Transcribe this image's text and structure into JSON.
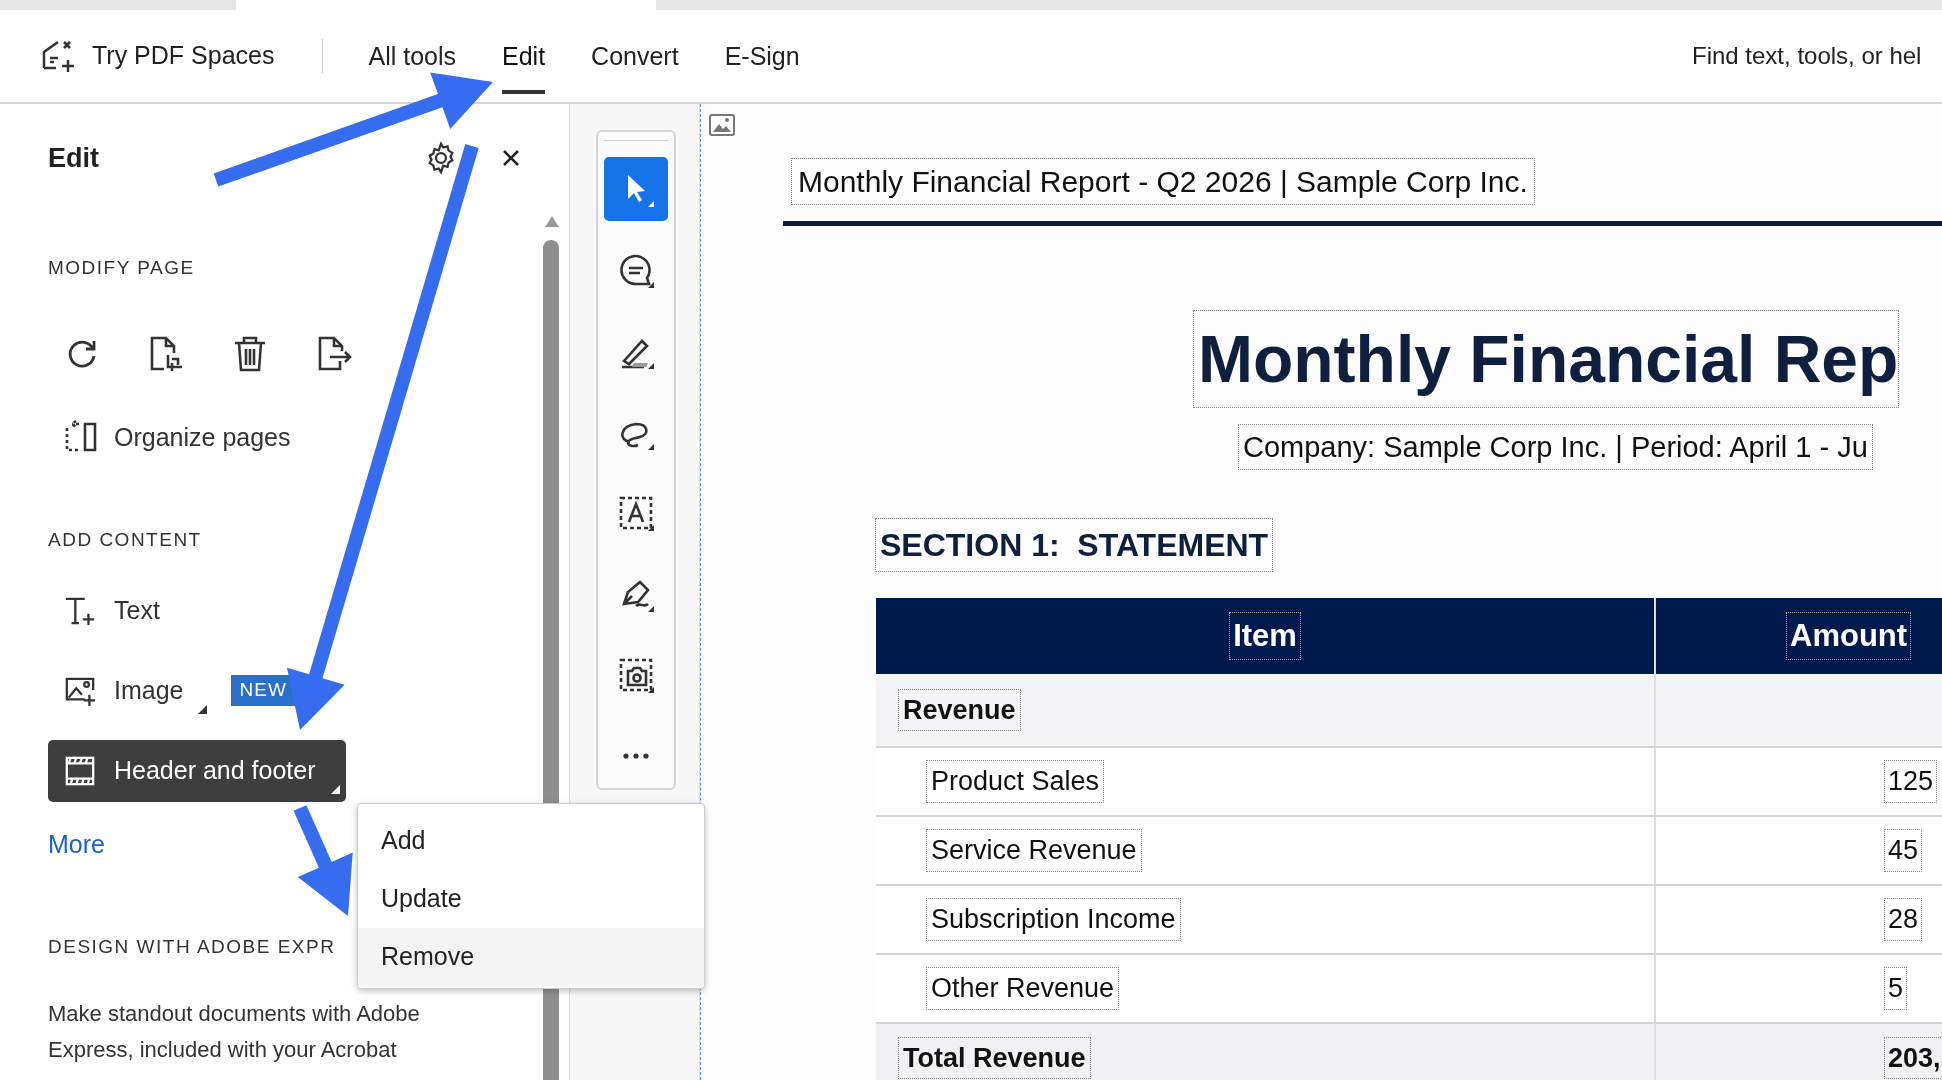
{
  "top_bar": {
    "brand": "Try PDF Spaces",
    "tabs": [
      {
        "label": "All tools",
        "selected": false
      },
      {
        "label": "Edit",
        "selected": true
      },
      {
        "label": "Convert",
        "selected": false
      },
      {
        "label": "E-Sign",
        "selected": false
      }
    ],
    "search": {
      "placeholder": "Find text, tools, or hel"
    }
  },
  "panel": {
    "title": "Edit",
    "modify_heading": "MODIFY PAGE",
    "organize_label": "Organize pages",
    "add_heading": "ADD CONTENT",
    "add_items": [
      {
        "kind": "text",
        "label": "Text",
        "selected": false,
        "has_menu": false
      },
      {
        "kind": "image",
        "label": "Image",
        "badge": "NEW",
        "selected": false,
        "has_menu": true
      },
      {
        "kind": "header_footer",
        "label": "Header and footer",
        "selected": true,
        "has_menu": true
      }
    ],
    "more": "More",
    "design_heading": "DESIGN WITH ADOBE EXPR",
    "design_text": "Make standout documents with Adobe Express, included with your Acrobat"
  },
  "menu": [
    {
      "label": "Add",
      "highlighted": false
    },
    {
      "label": "Update",
      "highlighted": false
    },
    {
      "label": "Remove",
      "highlighted": true
    }
  ],
  "tools": [
    {
      "kind": "select",
      "selected": true
    },
    {
      "kind": "comment",
      "selected": false
    },
    {
      "kind": "highlight",
      "selected": false
    },
    {
      "kind": "lasso",
      "selected": false
    },
    {
      "kind": "textbox",
      "selected": false
    },
    {
      "kind": "sign",
      "selected": false
    },
    {
      "kind": "snapshot",
      "selected": false
    },
    {
      "kind": "more",
      "selected": false
    }
  ],
  "document": {
    "header_text": "Monthly Financial Report - Q2 2026 | Sample Corp Inc.",
    "title": "Monthly Financial Rep",
    "subtitle": "Company: Sample Corp Inc. | Period: April 1 - Ju",
    "section": "SECTION 1:  STATEMENT",
    "table": {
      "columns": [
        "Item",
        "Amount"
      ],
      "rows": [
        {
          "kind": "group",
          "item": "Revenue"
        },
        {
          "kind": "item",
          "item": "Product Sales",
          "amount": "125"
        },
        {
          "kind": "item",
          "item": "Service Revenue",
          "amount": "45"
        },
        {
          "kind": "item",
          "item": "Subscription Income",
          "amount": "28"
        },
        {
          "kind": "item",
          "item": "Other Revenue",
          "amount": "5"
        },
        {
          "kind": "total",
          "item": "Total Revenue",
          "amount": "203,"
        }
      ]
    }
  }
}
